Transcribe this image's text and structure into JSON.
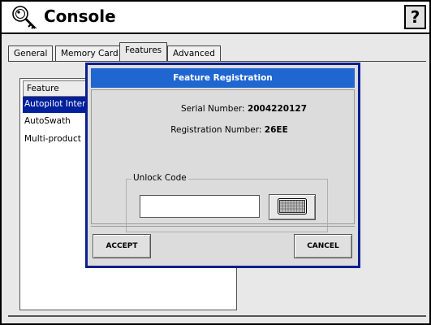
{
  "window": {
    "title": "Console",
    "help_label": "?"
  },
  "tabs": [
    {
      "label": "General"
    },
    {
      "label": "Memory Card"
    },
    {
      "label": "Features",
      "active": true
    },
    {
      "label": "Advanced"
    }
  ],
  "feature_list": {
    "header": "Feature",
    "items": [
      {
        "label": "Autopilot Interface",
        "selected": true
      },
      {
        "label": "AutoSwath"
      },
      {
        "label": "Multi-product"
      }
    ]
  },
  "dialog": {
    "title": "Feature Registration",
    "serial_label": "Serial Number:",
    "serial_value": "2004220127",
    "registration_label": "Registration Number:",
    "registration_value": "26EE",
    "unlock_label": "Unlock Code",
    "unlock_value": "",
    "accept_label": "ACCEPT",
    "cancel_label": "CANCEL"
  },
  "icons": {
    "title_icon": "key-icon",
    "keyboard_icon": "keyboard-icon"
  },
  "colors": {
    "dialog_border": "#0a1f8f",
    "dialog_title_bg": "#1f66d1",
    "selection_bg": "#001f9c"
  }
}
